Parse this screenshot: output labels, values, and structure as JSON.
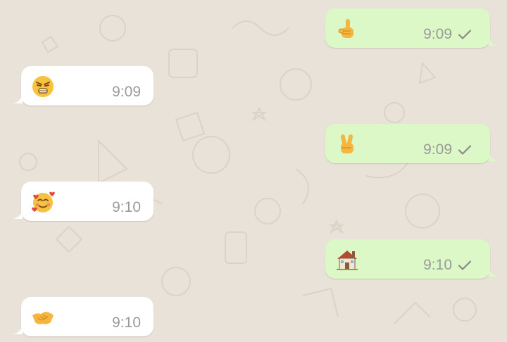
{
  "chat": {
    "messages": [
      {
        "direction": "outgoing",
        "emoji": "raised-index-finger",
        "time": "9:09",
        "status": "sent"
      },
      {
        "direction": "incoming",
        "emoji": "angry-face",
        "time": "9:09"
      },
      {
        "direction": "outgoing",
        "emoji": "victory-hand",
        "time": "9:09",
        "status": "sent"
      },
      {
        "direction": "incoming",
        "emoji": "smiling-face-with-hearts",
        "time": "9:10"
      },
      {
        "direction": "outgoing",
        "emoji": "house",
        "time": "9:10",
        "status": "sent"
      },
      {
        "direction": "incoming",
        "emoji": "handshake",
        "time": "9:10"
      }
    ]
  },
  "colors": {
    "background": "#e9e2d8",
    "incoming_bubble": "#ffffff",
    "outgoing_bubble": "#dcf8c6",
    "timestamp": "#9a9a9a",
    "check": "#8a8a8a"
  }
}
